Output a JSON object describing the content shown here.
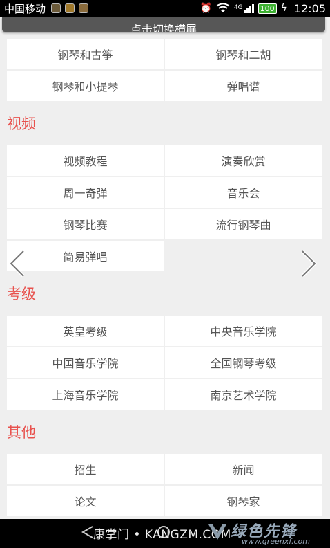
{
  "status_bar": {
    "carrier": "中国移动",
    "network": "4G",
    "battery": "100",
    "time": "12:05"
  },
  "rotate_bar": {
    "label": "点击切换横屏"
  },
  "top_grid": [
    "钢琴和古筝",
    "钢琴和二胡",
    "钢琴和小提琴",
    "弹唱谱"
  ],
  "sections": [
    {
      "title": "视频",
      "items": [
        "视频教程",
        "演奏欣赏",
        "周一奇弹",
        "音乐会",
        "钢琴比赛",
        "流行钢琴曲",
        "简易弹唱"
      ]
    },
    {
      "title": "考级",
      "items": [
        "英皇考级",
        "中央音乐学院",
        "中国音乐学院",
        "全国钢琴考级",
        "上海音乐学院",
        "南京艺术学院"
      ]
    },
    {
      "title": "其他",
      "items": [
        "招生",
        "新闻",
        "论文",
        "钢琴家"
      ]
    }
  ],
  "watermark": {
    "site": "康掌门 • KANGZM.COM",
    "brand": "绿色先锋",
    "url": "www.greenxf.com"
  },
  "colors": {
    "accent": "#e8514d",
    "status_bar": "#000000",
    "cell_bg": "#ffffff"
  },
  "icons": {
    "prev": "chevron-left-icon",
    "next": "chevron-right-icon"
  }
}
